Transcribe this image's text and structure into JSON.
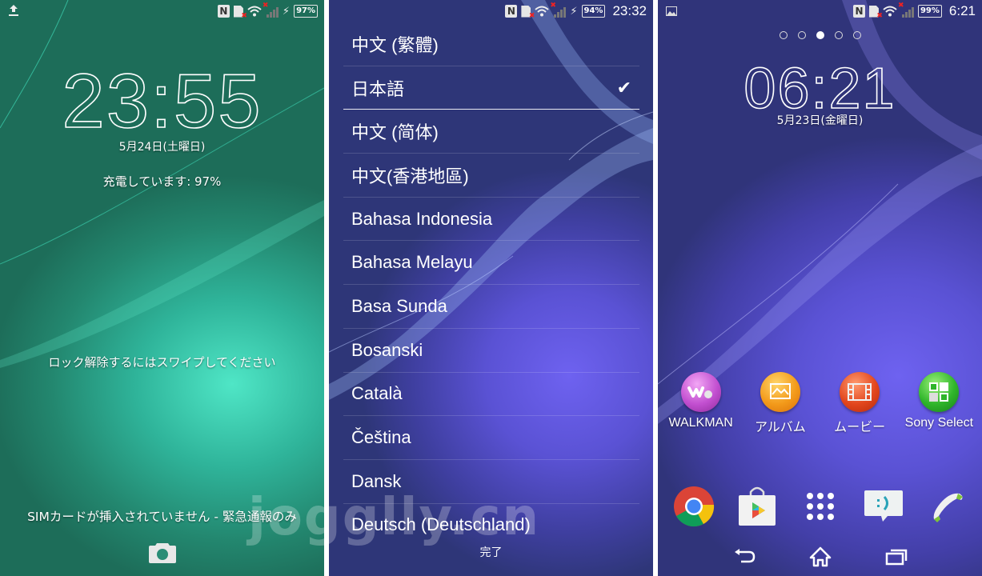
{
  "lockscreen": {
    "status_bar": {
      "left_icon": "upload-icon",
      "icons": [
        "nfc-icon",
        "no-sim-icon",
        "wifi-icon",
        "no-signal-icon",
        "charging-bolt-icon"
      ],
      "battery": "97%"
    },
    "clock": "23:55",
    "date": "5月24日(土曜日)",
    "charging": "充電しています: 97%",
    "unlock_hint": "ロック解除するにはスワイプしてください",
    "sim_status": "SIMカードが挿入されていません - 緊急通報のみ",
    "camera_icon": "camera-icon",
    "accent": "#2fb49a"
  },
  "language_picker": {
    "status_bar": {
      "icons": [
        "nfc-icon",
        "no-sim-icon",
        "wifi-icon",
        "no-signal-icon",
        "charging-bolt-icon"
      ],
      "battery": "94%",
      "time": "23:32"
    },
    "languages": [
      {
        "label": "中文 (繁體)",
        "selected": false
      },
      {
        "label": "日本語",
        "selected": true
      },
      {
        "label": "中文 (简体)",
        "selected": false
      },
      {
        "label": "中文(香港地區)",
        "selected": false
      },
      {
        "label": "Bahasa Indonesia",
        "selected": false
      },
      {
        "label": "Bahasa Melayu",
        "selected": false
      },
      {
        "label": "Basa Sunda",
        "selected": false
      },
      {
        "label": "Bosanski",
        "selected": false
      },
      {
        "label": "Català",
        "selected": false
      },
      {
        "label": "Čeština",
        "selected": false
      },
      {
        "label": "Dansk",
        "selected": false
      },
      {
        "label": "Deutsch (Deutschland)",
        "selected": false
      }
    ],
    "check_glyph": "✔",
    "done_label": "完了",
    "watermark": "jogglly.cn"
  },
  "homescreen": {
    "status_bar": {
      "left_icon": "picture-icon",
      "icons": [
        "nfc-icon",
        "no-sim-icon",
        "wifi-icon",
        "no-signal-icon"
      ],
      "battery": "99%",
      "time": "6:21"
    },
    "page_indicator": {
      "count": 5,
      "active": 3
    },
    "clock": "06:21",
    "date": "5月23日(金曜日)",
    "apps": [
      {
        "label": "WALKMAN",
        "icon": "walkman-icon",
        "color": "#c24fd0"
      },
      {
        "label": "アルバム",
        "icon": "album-icon",
        "color": "#f39a1a"
      },
      {
        "label": "ムービー",
        "icon": "movie-icon",
        "color": "#e2461d"
      },
      {
        "label": "Sony Select",
        "icon": "sony-select-icon",
        "color": "#2fb52a"
      }
    ],
    "dock": [
      {
        "name": "chrome",
        "icon": "chrome-icon"
      },
      {
        "name": "play-store",
        "icon": "play-store-icon"
      },
      {
        "name": "app-drawer",
        "icon": "app-drawer-icon"
      },
      {
        "name": "messaging",
        "icon": "messaging-icon"
      },
      {
        "name": "phone",
        "icon": "phone-icon"
      }
    ],
    "nav": [
      "back-icon",
      "home-icon",
      "recents-icon"
    ]
  }
}
